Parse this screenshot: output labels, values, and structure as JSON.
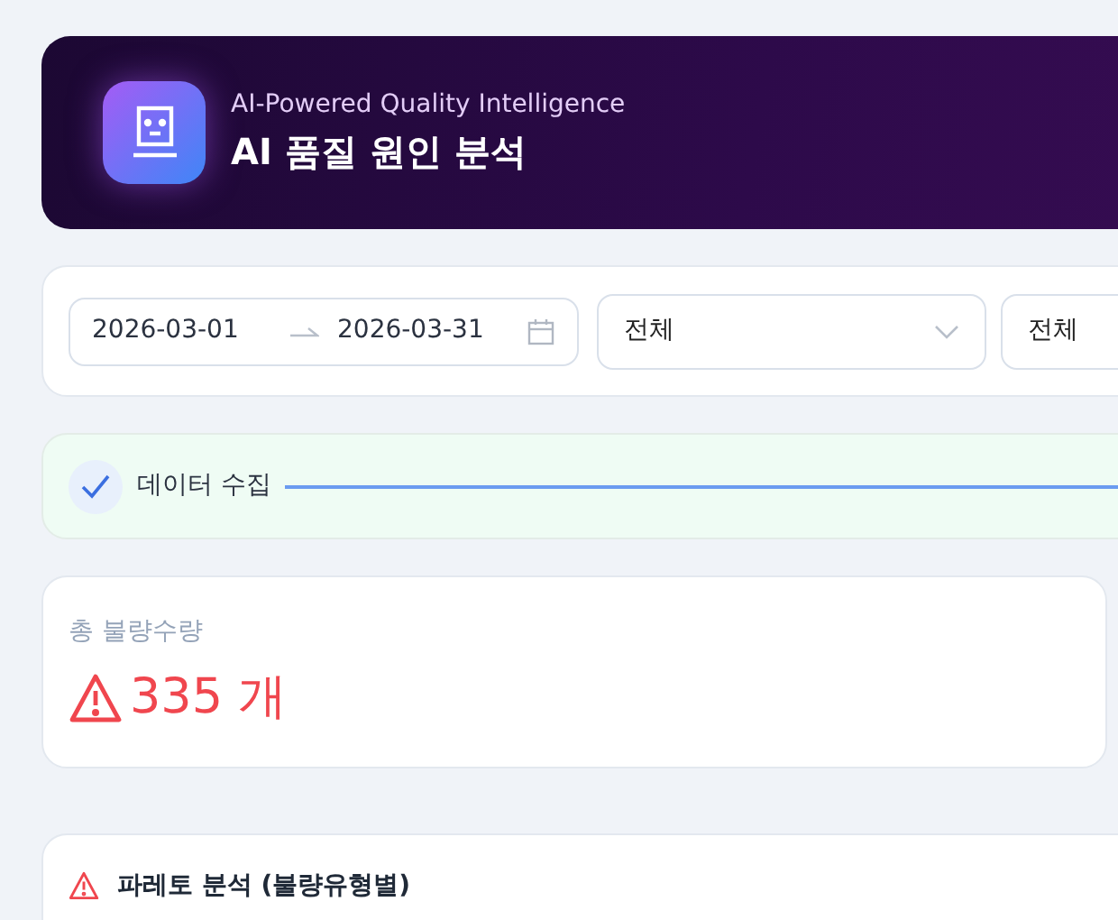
{
  "header": {
    "subtitle": "AI-Powered Quality Intelligence",
    "title": "AI 품질 원인 분석"
  },
  "filters": {
    "date_start": "2026-03-01",
    "date_end": "2026-03-31",
    "selects": [
      {
        "value": "전체"
      },
      {
        "value": "전체"
      }
    ]
  },
  "steps": [
    {
      "label": "데이터 수집",
      "completed": true
    }
  ],
  "kpi": {
    "label": "총 불량수량",
    "value": "335 개"
  },
  "pareto": {
    "title": "파레토 분석 (불량유형별)"
  }
}
